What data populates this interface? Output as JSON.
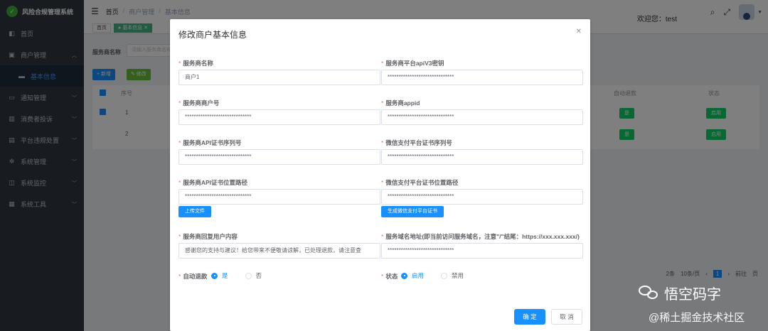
{
  "app": {
    "title": "风险合规管理系统"
  },
  "sidebar": {
    "items": [
      {
        "label": "首页",
        "icon": "dashboard-icon"
      },
      {
        "label": "商户管理",
        "icon": "shop-icon"
      },
      {
        "label": "基本信息",
        "icon": ""
      },
      {
        "label": "通知管理",
        "icon": "message-icon"
      },
      {
        "label": "消费者投诉",
        "icon": "complaint-icon"
      },
      {
        "label": "平台违规处置",
        "icon": "violation-icon"
      },
      {
        "label": "系统管理",
        "icon": "gear-icon"
      },
      {
        "label": "系统监控",
        "icon": "monitor-icon"
      },
      {
        "label": "系统工具",
        "icon": "tool-icon"
      }
    ]
  },
  "header": {
    "breadcrumb": [
      "首页",
      "商户管理",
      "基本信息"
    ],
    "welcome": "欢迎您：test"
  },
  "tags": {
    "home": "首页",
    "current": "基本信息"
  },
  "page": {
    "search_label": "服务商名称",
    "search_placeholder": "请输入服务商名称",
    "add_label": "+ 新增",
    "edit_label": "✎ 修改",
    "columns": [
      "序号",
      "自动退款",
      "状态"
    ],
    "rows": [
      {
        "index": "1",
        "auto_refund": "是",
        "status": "启用"
      },
      {
        "index": "2",
        "auto_refund": "是",
        "status": "启用"
      }
    ],
    "pager": {
      "total": "2条",
      "page_size": "10条/页",
      "current": "1",
      "goto": "前往",
      "page_unit": "页"
    }
  },
  "dialog": {
    "title": "修改商户基本信息",
    "fields": {
      "name": {
        "label": "服务商名称",
        "value": "商户1"
      },
      "apiv3": {
        "label": "服务商平台apiV3密钥",
        "value": "******************************"
      },
      "mchid": {
        "label": "服务商商户号",
        "value": "******************************"
      },
      "appid": {
        "label": "服务商appid",
        "value": "******************************"
      },
      "cert_serial": {
        "label": "服务商API证书序列号",
        "value": "******************************"
      },
      "wx_cert_serial": {
        "label": "微信支付平台证书序列号",
        "value": "******************************"
      },
      "cert_path": {
        "label": "服务商API证书位置路径",
        "value": "******************************"
      },
      "wx_cert_path": {
        "label": "微信支付平台证书位置路径",
        "value": "******************************"
      },
      "reply": {
        "label": "服务商回复用户内容",
        "value": "感谢您的支持与建议！给您带来不便敬请谅解，已处理退款，请注意查"
      },
      "domain": {
        "label": "服务域名地址(即当前访问服务域名，注意\"/\"结尾：https://xxx.xxx.xxx/)",
        "value": "******************************"
      }
    },
    "upload_label": "上传文件",
    "gen_cert_label": "生成微信支付平台证书",
    "auto_refund": {
      "label": "自动退款",
      "options": [
        "是",
        "否"
      ],
      "selected": "是"
    },
    "status": {
      "label": "状态",
      "options": [
        "启用",
        "禁用"
      ],
      "selected": "启用"
    },
    "confirm_label": "确 定",
    "cancel_label": "取 消"
  },
  "watermark": {
    "line1": "悟空码字",
    "line2": "@稀土掘金技术社区"
  },
  "colors": {
    "primary": "#1890ff",
    "sidebar": "#30363f",
    "success": "#13ce66",
    "required": "#f56c6c"
  }
}
